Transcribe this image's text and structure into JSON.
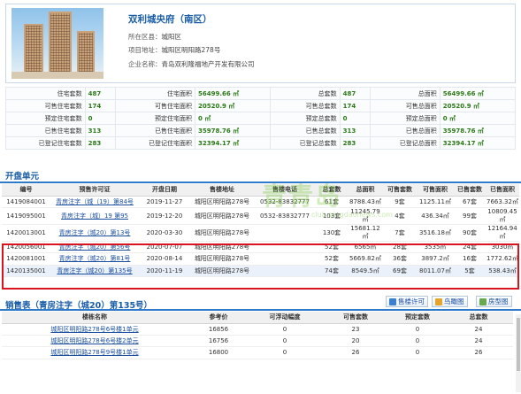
{
  "project": {
    "title": "双利城央府（南区）",
    "district_label": "所在区县：",
    "district": "城阳区",
    "address_label": "项目地址：",
    "address": "城阳区明阳路278号",
    "company_label": "企业名称：",
    "company": "青岛双利隆福地产开发有限公司"
  },
  "stats": {
    "rows": [
      [
        "住宅套数",
        "487",
        "住宅面积",
        "56499.66 ㎡",
        "总套数",
        "487",
        "总面积",
        "56499.66 ㎡"
      ],
      [
        "可售住宅套数",
        "174",
        "可售住宅面积",
        "20520.9 ㎡",
        "可售总套数",
        "174",
        "可售总面积",
        "20520.9 ㎡"
      ],
      [
        "预定住宅套数",
        "0",
        "预定住宅面积",
        "0 ㎡",
        "预定总套数",
        "0",
        "预定总面积",
        "0 ㎡"
      ],
      [
        "已售住宅套数",
        "313",
        "已售住宅面积",
        "35978.76 ㎡",
        "已售总套数",
        "313",
        "已售总面积",
        "35978.76 ㎡"
      ],
      [
        "已登记住宅套数",
        "283",
        "已登记住宅面积",
        "32394.17 ㎡",
        "已登记总套数",
        "283",
        "已登记总面积",
        "32394.17 ㎡"
      ]
    ]
  },
  "units_section": {
    "title": "开盘单元",
    "columns": [
      "编号",
      "预售许可证",
      "开盘日期",
      "售楼地址",
      "售楼电话",
      "总套数",
      "总面积",
      "可售套数",
      "可售面积",
      "已售套数",
      "已售面积"
    ],
    "rows": [
      [
        "1419084001",
        "青房注字（城（19）第84号",
        "2019-11-27",
        "城阳区明阳路278号",
        "0532-83832777",
        "61套",
        "8788.43㎡",
        "9套",
        "1125.11㎡",
        "67套",
        "7663.32㎡"
      ],
      [
        "1419095001",
        "青房注字（城）19 第95",
        "2019-12-20",
        "城阳区明阳路278号",
        "0532-83832777",
        "103套",
        "11245.79㎡",
        "4套",
        "436.34㎡",
        "99套",
        "10809.45㎡"
      ],
      [
        "1420013001",
        "青房注字（城20）第13号",
        "2020-03-30",
        "城阳区明阳路278号",
        "",
        "130套",
        "15681.12㎡",
        "7套",
        "3516.18㎡",
        "90套",
        "12164.94㎡"
      ],
      [
        "1420056001",
        "青房注字（城20）第56号",
        "2020-07-07",
        "城阳区明阳路278号",
        "",
        "52套",
        "6565㎡",
        "28套",
        "3535㎡",
        "24套",
        "3030㎡"
      ],
      [
        "1420081001",
        "青房注字（城20）第81号",
        "2020-08-14",
        "城阳区明阳路278号",
        "",
        "52套",
        "5669.82㎡",
        "36套",
        "3897.2㎡",
        "16套",
        "1772.62㎡"
      ],
      [
        "1420135001",
        "青房注字（城20）第135号",
        "2020-11-19",
        "城阳区明阳路278号",
        "",
        "74套",
        "8549.5㎡",
        "69套",
        "8011.07㎡",
        "5套",
        "538.43㎡"
      ]
    ]
  },
  "sales": {
    "title": "销售表（青房注字（城20）第135号）",
    "buttons": [
      "售楼许可",
      "鸟瞰图",
      "房型图"
    ],
    "columns": [
      "楼栋名称",
      "参考价",
      "可浮动幅度",
      "可售套数",
      "预定套数",
      "总套数"
    ],
    "rows": [
      [
        "城阳区明阳路278号6号楼1单元",
        "16856",
        "0",
        "23",
        "0",
        "24"
      ],
      [
        "城阳区明阳路278号6号楼2单元",
        "16756",
        "0",
        "20",
        "0",
        "24"
      ],
      [
        "城阳区明阳路278号9号楼1单元",
        "16800",
        "0",
        "26",
        "0",
        "26"
      ]
    ]
  },
  "watermark": {
    "main": "青青岛",
    "sub": "club.qingdaonews.com"
  },
  "colors": {
    "accent": "#1a5ea8",
    "value": "#2a7a16",
    "highlight": "#d9141e"
  }
}
